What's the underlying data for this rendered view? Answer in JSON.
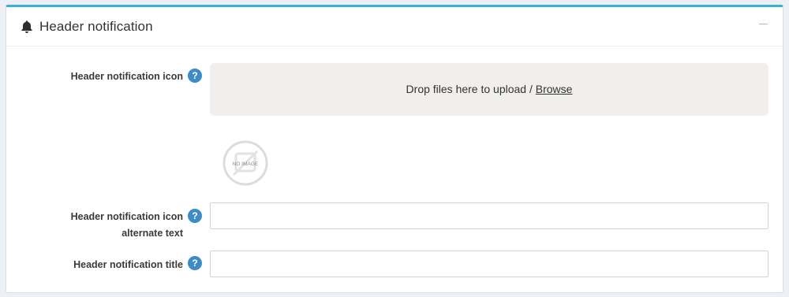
{
  "panel": {
    "title": "Header notification",
    "title_icon": "bell-icon",
    "collapse_icon": "minus-icon",
    "accent_color": "#3ab0dc"
  },
  "fields": {
    "icon": {
      "label": "Header notification icon",
      "help_icon": "?",
      "dropzone_text": "Drop files here to upload / ",
      "browse_label": "Browse",
      "placeholder_image_text": "NO IMAGE"
    },
    "alt_text": {
      "label_line1": "Header notification icon",
      "label_line2": "alternate text",
      "help_icon": "?",
      "value": ""
    },
    "title": {
      "label": "Header notification title",
      "help_icon": "?",
      "value": ""
    }
  }
}
